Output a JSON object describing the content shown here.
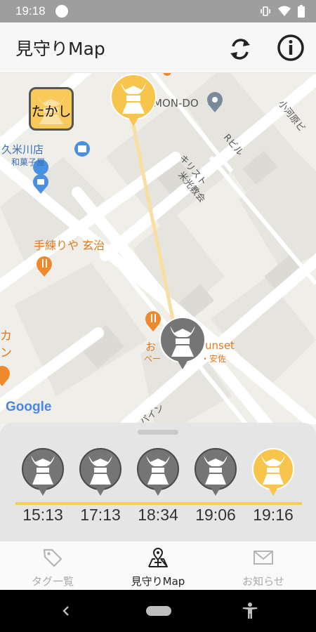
{
  "status_bar": {
    "time": "19:18",
    "icons": [
      "vibrate-icon",
      "wifi-icon",
      "battery-icon"
    ]
  },
  "app_bar": {
    "title": "見守りMap",
    "actions": [
      "refresh-icon",
      "info-icon"
    ]
  },
  "map": {
    "labels": {
      "mon_do": "MON-DO",
      "r_biru": "Rビル",
      "kirisuto": "キリスト",
      "kyoukai": "米光教会",
      "kumekawa": "久米川店",
      "wagashi": "和菓子屋",
      "teneri": "手練りや 玄治",
      "kodaira": "小河原ビ",
      "sunset": "unset",
      "o": "お",
      "pe": "ペー",
      "yasuda": "・安佐",
      "ka": "カ",
      "n": "ン",
      "pine": "パイン",
      "google": "Google"
    },
    "user_tag": "たかし",
    "colors": {
      "route": "#f8dea0",
      "active_pin": "#f7c44c",
      "inactive_pin": "#757575"
    }
  },
  "timeline": {
    "times": [
      "15:13",
      "17:13",
      "18:34",
      "19:06",
      "19:16"
    ],
    "active_index": 4
  },
  "bottom_nav": {
    "items": [
      {
        "label": "タグ一覧",
        "icon": "tag-icon",
        "selected": false
      },
      {
        "label": "見守りMap",
        "icon": "map-icon",
        "selected": true
      },
      {
        "label": "お知らせ",
        "icon": "mail-icon",
        "selected": false
      }
    ]
  },
  "system_nav": [
    "back-icon",
    "home-pill",
    "accessibility-icon"
  ]
}
